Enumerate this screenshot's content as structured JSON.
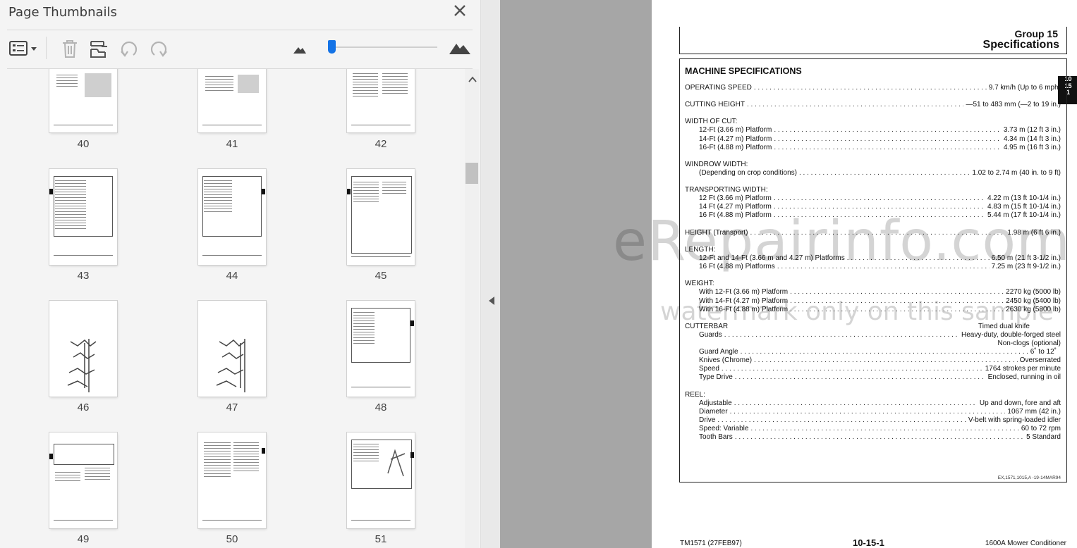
{
  "panel": {
    "title": "Page Thumbnails",
    "toolbar": {
      "options_icon": "list-options-icon",
      "delete_icon": "trash-icon",
      "insert_icon": "insert-pages-icon",
      "undo_icon": "rotate-ccw-icon",
      "redo_icon": "rotate-cw-icon",
      "zoom_out_icon": "small-mountain-icon",
      "zoom_in_icon": "large-mountain-icon",
      "zoom_level": 0.03
    },
    "thumbnails": [
      {
        "label": "40"
      },
      {
        "label": "41"
      },
      {
        "label": "42"
      },
      {
        "label": "43"
      },
      {
        "label": "44"
      },
      {
        "label": "45"
      },
      {
        "label": "46"
      },
      {
        "label": "47"
      },
      {
        "label": "48"
      },
      {
        "label": "49"
      },
      {
        "label": "50"
      },
      {
        "label": "51"
      }
    ]
  },
  "colors": {
    "accent": "#1473e6",
    "panel_bg": "#f4f4f4",
    "doc_bg": "#a6a6a6"
  },
  "document": {
    "group": "Group 15",
    "title": "Specifications",
    "heading": "MACHINE SPECIFICATIONS",
    "side_tab": [
      "10",
      "15",
      "1"
    ],
    "specs": {
      "operating_speed": {
        "label": "OPERATING SPEED",
        "value": "9.7 km/h (Up to 6 mph)"
      },
      "cutting_height": {
        "label": "CUTTING HEIGHT",
        "value": "—51 to 483 mm (—2 to 19 in.)"
      },
      "width_of_cut": "WIDTH OF CUT:",
      "w12": {
        "label": "12-Ft (3.66 m) Platform",
        "value": "3.73 m (12 ft 3 in.)"
      },
      "w14": {
        "label": "14-Ft (4.27 m) Platform",
        "value": "4.34 m (14 ft 3 in.)"
      },
      "w16": {
        "label": "16-Ft (4.88 m) Platform",
        "value": "4.95 m (16 ft 3 in.)"
      },
      "windrow_width": "WINDROW WIDTH:",
      "windrow": {
        "label": "(Depending on crop conditions)",
        "value": "1.02 to 2.74 m (40 in. to 9 ft)"
      },
      "transporting_width": "TRANSPORTING WIDTH:",
      "t12": {
        "label": "12 Ft (3.66 m) Platform",
        "value": "4.22 m (13 ft 10-1/4 in.)"
      },
      "t14": {
        "label": "14 Ft (4.27 m) Platform",
        "value": "4.83 m (15 ft 10-1/4 in.)"
      },
      "t16": {
        "label": "16 Ft (4.88 m) Platform",
        "value": "5.44 m (17 ft 10-1/4 in.)"
      },
      "height": {
        "label": "HEIGHT (Transport)",
        "value": "1.98 m (6 ft 6 in.)"
      },
      "length": "LENGTH:",
      "l1214": {
        "label": "12-Ft and 14-Ft (3.66 m and 4.27 m) Platforms",
        "value": "6.50 m (21 ft 3-1/2 in.)"
      },
      "l16": {
        "label": "16 Ft (4.88 m) Platforms",
        "value": "7.25 m (23 ft 9-1/2 in.)"
      },
      "weight": "WEIGHT:",
      "wt12": {
        "label": "With 12-Ft (3.66 m) Platform",
        "value": "2270 kg (5000 lb)"
      },
      "wt14": {
        "label": "With 14-Ft (4.27 m) Platform",
        "value": "2450 kg (5400 lb)"
      },
      "wt16": {
        "label": "With 16-Ft (4.88 m) Platform",
        "value": "2630 kg (5800 lb)"
      },
      "cutterbar": {
        "label": "CUTTERBAR",
        "value": "Timed dual knife"
      },
      "guards": {
        "label": "Guards",
        "value": "Heavy-duty, double-forged steel"
      },
      "nonclogs": "Non-clogs (optional)",
      "guard_angle": {
        "label": "Guard Angle",
        "value": "6˚ to 12˚"
      },
      "knives": {
        "label": "Knives (Chrome)",
        "value": "Overserrated"
      },
      "speed": {
        "label": "Speed",
        "value": "1764 strokes per minute"
      },
      "type_drive": {
        "label": "Type Drive",
        "value": "Enclosed, running in oil"
      },
      "reel": "REEL:",
      "adjustable": {
        "label": "Adjustable",
        "value": "Up and down, fore and aft"
      },
      "diameter": {
        "label": "Diameter",
        "value": "1067 mm (42 in.)"
      },
      "drive": {
        "label": "Drive",
        "value": "V-belt with spring-loaded idler"
      },
      "speed_variable": {
        "label": "Speed: Variable",
        "value": "60 to 72 rpm"
      },
      "tooth_bars": {
        "label": "Tooth Bars",
        "value": "5 Standard"
      }
    },
    "box_code": "EX,1571,1015,A -19-14MAR94",
    "watermark_main": "eRepairinfo.com",
    "watermark_sub": "watermark only on this sample",
    "footer": {
      "left": "TM1571 (27FEB97)",
      "center": "10-15-1",
      "right": "1600A Mower Conditioner"
    }
  }
}
